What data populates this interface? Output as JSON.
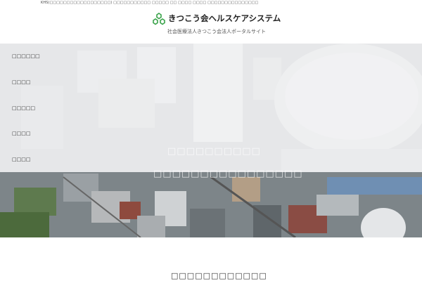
{
  "topbar": {
    "text": "KHS(□□□□□□□□□□□□□□□□□□) □□□□□□□□□□□ □□□□□ □□ □□□□ □□□□ □□□□□□□□□□□□□□□"
  },
  "header": {
    "title": "きつこう会ヘルスケアシステム",
    "subtitle": "社会医療法人きつこう会法人ポータルサイト",
    "brand_color": "#3aa34a"
  },
  "nav": {
    "items": [
      {
        "label": "□□□□□□"
      },
      {
        "label": "□□□□"
      },
      {
        "label": "□□□□□"
      },
      {
        "label": "□□□□"
      },
      {
        "label": "□□□□"
      }
    ]
  },
  "hero": {
    "heading": "□□□□□□□□□□",
    "subheading": "□□□□□□□□□□□□□□□□"
  },
  "section": {
    "title": "□□□□□□□□□□□□"
  }
}
